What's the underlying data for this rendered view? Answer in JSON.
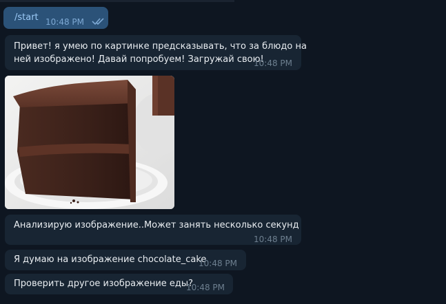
{
  "messages": [
    {
      "id": "m1",
      "direction": "outgoing",
      "text": "/start",
      "time": "10:48 PM",
      "status": "read"
    },
    {
      "id": "m2",
      "direction": "incoming",
      "lines": [
        "Привет! я умею по картинке предсказывать, что за блюдо на",
        "ней изображено! Давай попробуем! Загружай свою!"
      ],
      "time": "10:48 PM"
    },
    {
      "id": "m3",
      "direction": "incoming",
      "type": "photo",
      "image_description": "chocolate-cake-slice"
    },
    {
      "id": "m4",
      "direction": "incoming",
      "text": "Анализирую изображение..Может занять несколько секунд",
      "time": "10:48 PM"
    },
    {
      "id": "m5",
      "direction": "incoming",
      "text": "Я думаю на изображение chocolate_cake",
      "time": "10:48 PM"
    },
    {
      "id": "m6",
      "direction": "incoming",
      "text": "Проверить другое изображение еды?",
      "time": "10:48 PM"
    }
  ],
  "colors": {
    "background": "#0e1621",
    "incoming_bubble": "#182533",
    "outgoing_bubble": "#2b5278",
    "text": "#e9edf1",
    "time_incoming": "#6d7f8f",
    "time_outgoing": "#7da8d3"
  },
  "icons": {
    "read_status": "double-check-icon"
  }
}
